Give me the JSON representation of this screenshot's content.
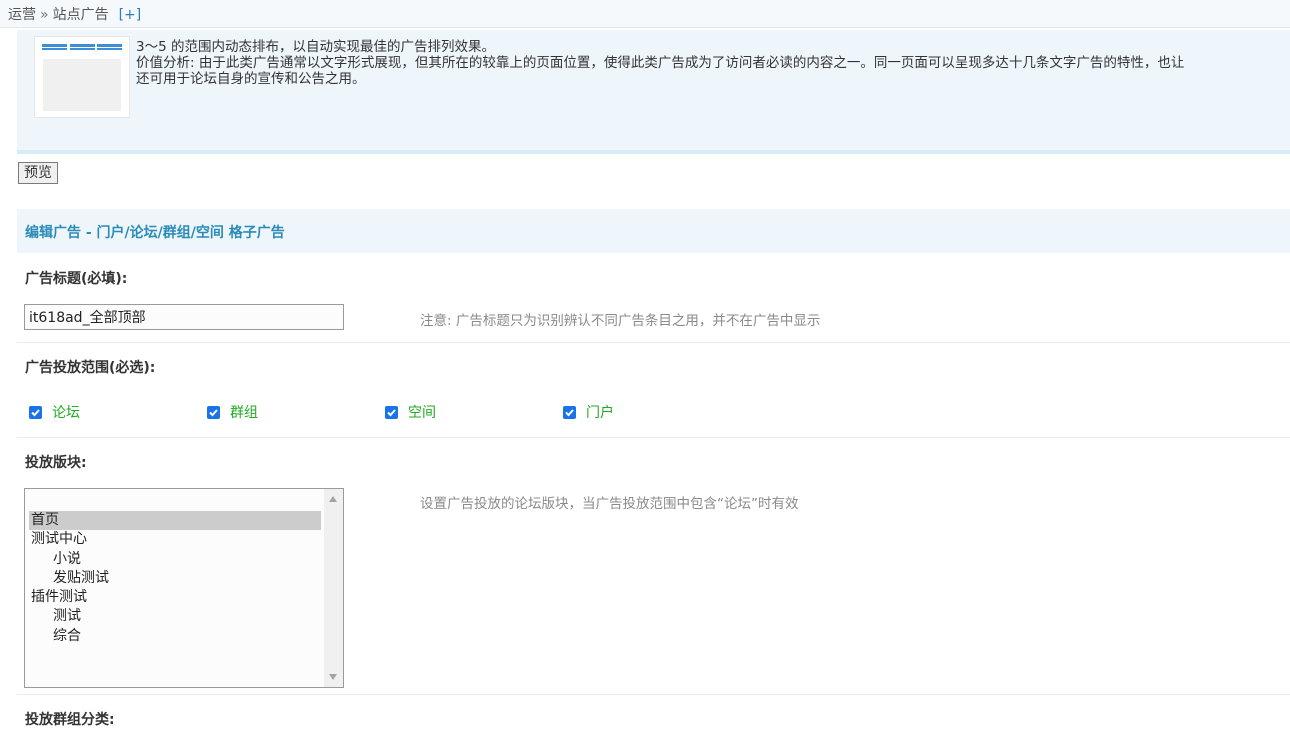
{
  "breadcrumb": {
    "root": "运营",
    "separator": "»",
    "current": "站点广告",
    "expand": "[+]"
  },
  "info": {
    "line1": "3～5 的范围内动态排布，以自动实现最佳的广告排列效果。",
    "line2": "价值分析: 由于此类广告通常以文字形式展现，但其所在的较靠上的页面位置，使得此类广告成为了访问者必读的内容之一。同一页面可以呈现多达十几条文字广告的特性，也让",
    "line3": "还可用于论坛自身的宣传和公告之用。"
  },
  "preview_button": "预览",
  "section_title": "编辑广告 - 门户/论坛/群组/空间 格子广告",
  "title_field": {
    "label": "广告标题(必填):",
    "value": "it618ad_全部顶部",
    "hint": "注意: 广告标题只为识别辨认不同广告条目之用，并不在广告中显示"
  },
  "scope": {
    "label": "广告投放范围(必选):",
    "options": [
      {
        "label": "论坛",
        "checked": true
      },
      {
        "label": "群组",
        "checked": true
      },
      {
        "label": "空间",
        "checked": true
      },
      {
        "label": "门户",
        "checked": true
      }
    ]
  },
  "forums": {
    "label": "投放版块:",
    "hint": "设置广告投放的论坛版块，当广告投放范围中包含“论坛”时有效",
    "options": [
      {
        "label": "首页",
        "selected": true,
        "level": 0
      },
      {
        "label": "测试中心",
        "selected": false,
        "level": 0
      },
      {
        "label": "小说",
        "selected": false,
        "level": 1
      },
      {
        "label": "发贴测试",
        "selected": false,
        "level": 1
      },
      {
        "label": "插件测试",
        "selected": false,
        "level": 0
      },
      {
        "label": "测试",
        "selected": false,
        "level": 1
      },
      {
        "label": "综合",
        "selected": false,
        "level": 1
      }
    ]
  },
  "groups": {
    "label": "投放群组分类:"
  },
  "colors": {
    "accent": "#2a8bb8",
    "checkbox": "#1a73e8",
    "option_text": "#22aa22",
    "panel_bg": "#eef6fc"
  }
}
